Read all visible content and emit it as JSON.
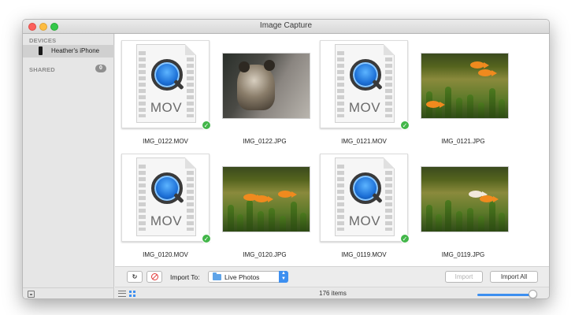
{
  "window": {
    "title": "Image Capture"
  },
  "sidebar": {
    "devices_header": "DEVICES",
    "device_name": "Heather's iPhone",
    "shared_header": "SHARED",
    "shared_count": "0"
  },
  "items": [
    {
      "name": "IMG_0122.MOV",
      "kind": "mov",
      "imported": true,
      "badge_text": "MOV"
    },
    {
      "name": "IMG_0122.JPG",
      "kind": "photo-dog",
      "imported": false
    },
    {
      "name": "IMG_0121.MOV",
      "kind": "mov",
      "imported": true,
      "badge_text": "MOV"
    },
    {
      "name": "IMG_0121.JPG",
      "kind": "photo-fish",
      "imported": false
    },
    {
      "name": "IMG_0120.MOV",
      "kind": "mov",
      "imported": true,
      "badge_text": "MOV"
    },
    {
      "name": "IMG_0120.JPG",
      "kind": "photo-fish",
      "imported": false
    },
    {
      "name": "IMG_0119.MOV",
      "kind": "mov",
      "imported": true,
      "badge_text": "MOV"
    },
    {
      "name": "IMG_0119.JPG",
      "kind": "photo-fish",
      "imported": false
    }
  ],
  "toolbar": {
    "rotate_label": "↻",
    "import_to_label": "Import To:",
    "destination": "Live Photos",
    "import_label": "Import",
    "import_all_label": "Import All"
  },
  "status": {
    "item_count": "176 items",
    "thumbnail_size": 0.95
  },
  "colors": {
    "accent": "#3d8ff0",
    "check": "#42b649",
    "delete": "#e03a3a"
  },
  "icons": {
    "view_list": "list-view-icon",
    "view_grid": "grid-view-icon",
    "folder": "folder-icon",
    "check": "checkmark-icon"
  }
}
